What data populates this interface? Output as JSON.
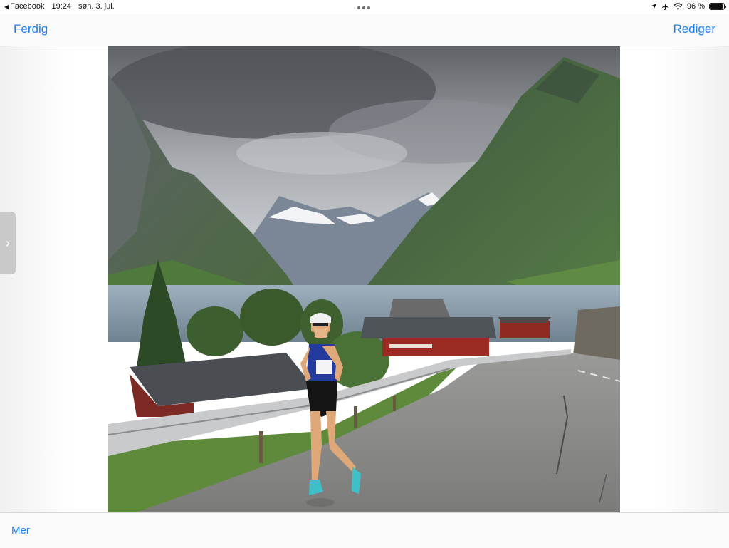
{
  "status_bar": {
    "back_app": "Facebook",
    "time": "19:24",
    "date": "søn. 3. jul.",
    "battery": "96 %",
    "battery_level": 0.96,
    "icons": [
      "location-arrow-icon",
      "airplane-icon",
      "wifi-icon",
      "battery-icon"
    ]
  },
  "navbar": {
    "done_label": "Ferdig",
    "edit_label": "Rediger"
  },
  "photo": {
    "subject": "runner-on-road-by-fjord"
  },
  "toolbar": {
    "more_label": "Mer"
  },
  "colors": {
    "accent": "#1e7ff2"
  }
}
